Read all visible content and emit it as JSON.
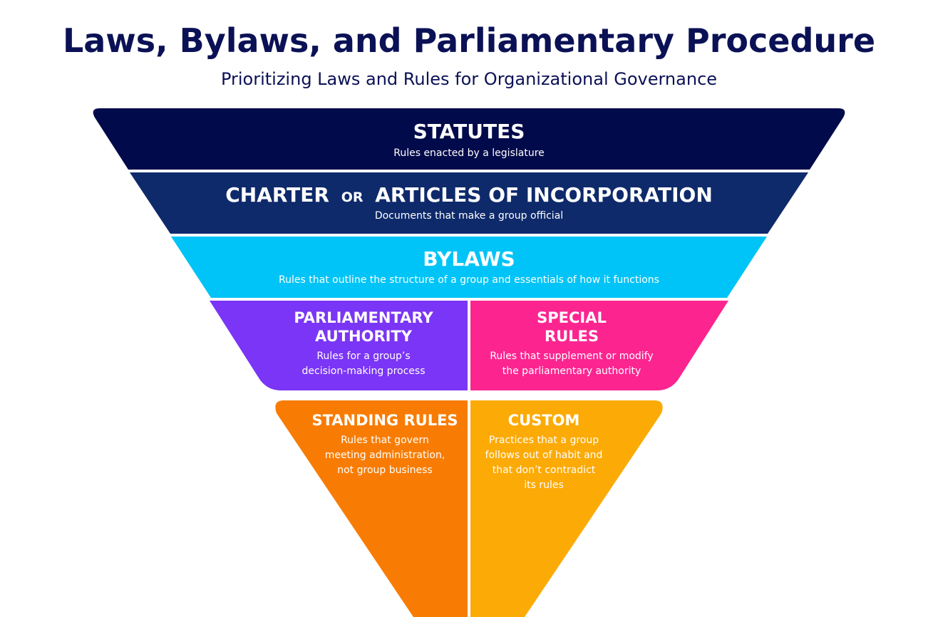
{
  "header": {
    "title": "Laws, Bylaws, and Parliamentary Procedure",
    "subtitle": "Prioritizing Laws and Rules for Organizational Governance"
  },
  "tiers": {
    "statutes": {
      "heading": "STATUTES",
      "description": "Rules enacted by a legislature",
      "color": "#010a4a"
    },
    "charter": {
      "heading_part1": "CHARTER",
      "heading_connector": "OR",
      "heading_part2": "ARTICLES OF INCORPORATION",
      "description": "Documents that make a group official",
      "color": "#0e2a6b"
    },
    "bylaws": {
      "heading": "BYLAWS",
      "description": "Rules that outline the structure of a group and essentials of how it functions",
      "color": "#00c4f7"
    },
    "parliamentary_authority": {
      "heading_line1": "PARLIAMENTARY",
      "heading_line2": "AUTHORITY",
      "description_line1": "Rules for a group’s",
      "description_line2": "decision-making process",
      "color": "#7b35f6"
    },
    "special_rules": {
      "heading_line1": "SPECIAL",
      "heading_line2": "RULES",
      "description_line1": "Rules that supplement or modify",
      "description_line2": "the parliamentary authority",
      "color": "#fc2590"
    },
    "standing_rules": {
      "heading": "STANDING RULES",
      "description_line1": "Rules that govern",
      "description_line2": "meeting administration,",
      "description_line3": "not group business",
      "color": "#f87c03"
    },
    "custom": {
      "heading": "CUSTOM",
      "description_line1": "Practices that a group",
      "description_line2": "follows out of habit and",
      "description_line3": "that don’t contradict",
      "description_line4": "its rules",
      "color": "#fcaa06"
    }
  }
}
